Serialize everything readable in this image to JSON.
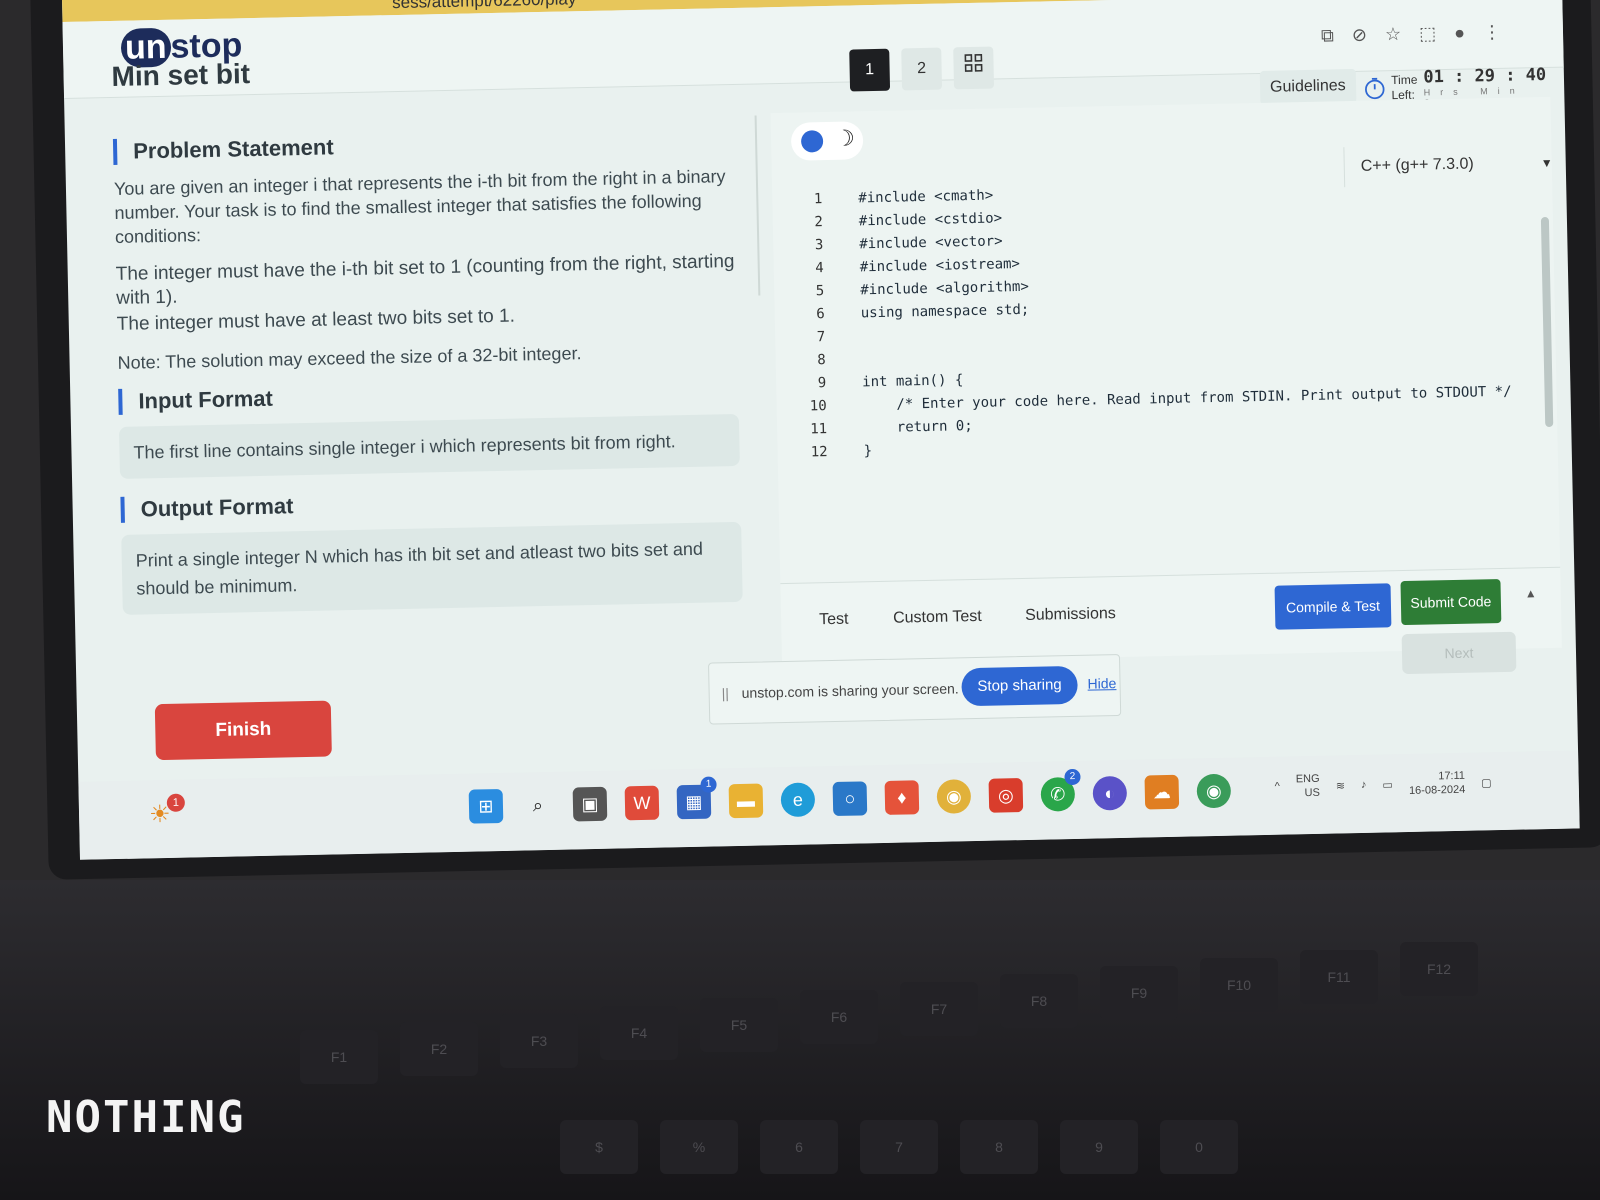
{
  "browser": {
    "url_fragment": "sess/attempt/62260/play",
    "minimize": "–",
    "restore": "▫",
    "close": "✕",
    "icons": [
      "cast-icon",
      "eye-off-icon",
      "star-icon",
      "extensions-icon",
      "profile-icon",
      "more-icon"
    ]
  },
  "app": {
    "logo_un": "un",
    "logo_stop": "stop",
    "problem_title": "Min set bit",
    "question_tabs": [
      "1",
      "2"
    ],
    "guidelines_label": "Guidelines",
    "time_left_label_1": "Time",
    "time_left_label_2": "Left:",
    "time_value": "01 : 29 : 40",
    "time_units": "Hrs Min Sec"
  },
  "problem": {
    "statement_heading": "Problem Statement",
    "statement_p1": "You are given an integer i that represents the i-th bit from the right in a binary number. Your task is to find the smallest integer that satisfies the following conditions:",
    "statement_p2": "The integer must have the i-th bit set to 1 (counting from the right, starting with 1).",
    "statement_p3": "The integer must have at least two bits set to 1.",
    "statement_note": "Note: The solution may exceed the size of a 32-bit integer.",
    "input_heading": "Input Format",
    "input_text": "The first line contains single integer i which represents bit from right.",
    "output_heading": "Output Format",
    "output_text": "Print a single integer N which has ith bit set and atleast two bits set and should be minimum."
  },
  "editor": {
    "language": "C++ (g++ 7.3.0)",
    "lines": [
      {
        "n": "1",
        "text": "#include <cmath>"
      },
      {
        "n": "2",
        "text": "#include <cstdio>"
      },
      {
        "n": "3",
        "text": "#include <vector>"
      },
      {
        "n": "4",
        "text": "#include <iostream>"
      },
      {
        "n": "5",
        "text": "#include <algorithm>"
      },
      {
        "n": "6",
        "text": "using namespace std;"
      },
      {
        "n": "7",
        "text": ""
      },
      {
        "n": "8",
        "text": ""
      },
      {
        "n": "9",
        "text": "int main() {"
      },
      {
        "n": "10",
        "text": "    /* Enter your code here. Read input from STDIN. Print output to STDOUT */"
      },
      {
        "n": "11",
        "text": "    return 0;"
      },
      {
        "n": "12",
        "text": "}"
      }
    ]
  },
  "bottom": {
    "tab_test": "Test",
    "tab_custom": "Custom Test",
    "tab_submissions": "Submissions",
    "compile_label": "Compile & Test",
    "submit_label": "Submit Code",
    "next_label": "Next",
    "finish_label": "Finish"
  },
  "share": {
    "message": "unstop.com is sharing your screen.",
    "stop_label": "Stop sharing",
    "hide_label": "Hide"
  },
  "taskbar": {
    "weather_badge": "1",
    "store_badge": "1",
    "whatsapp_badge": "2",
    "lang_1": "ENG",
    "lang_2": "US",
    "time": "17:11",
    "date": "16-08-2024"
  },
  "device": {
    "brand": "NOTHING",
    "keys": [
      "F1",
      "F2",
      "F3",
      "F4",
      "F5",
      "F6",
      "F7",
      "F8",
      "F9",
      "F10",
      "F11",
      "F12",
      "$",
      "%",
      "6",
      "7",
      "8",
      "9",
      "0"
    ]
  },
  "colors": {
    "accent_blue": "#2e67d3",
    "finish_red": "#d9453e",
    "submit_green": "#2e7d36"
  }
}
